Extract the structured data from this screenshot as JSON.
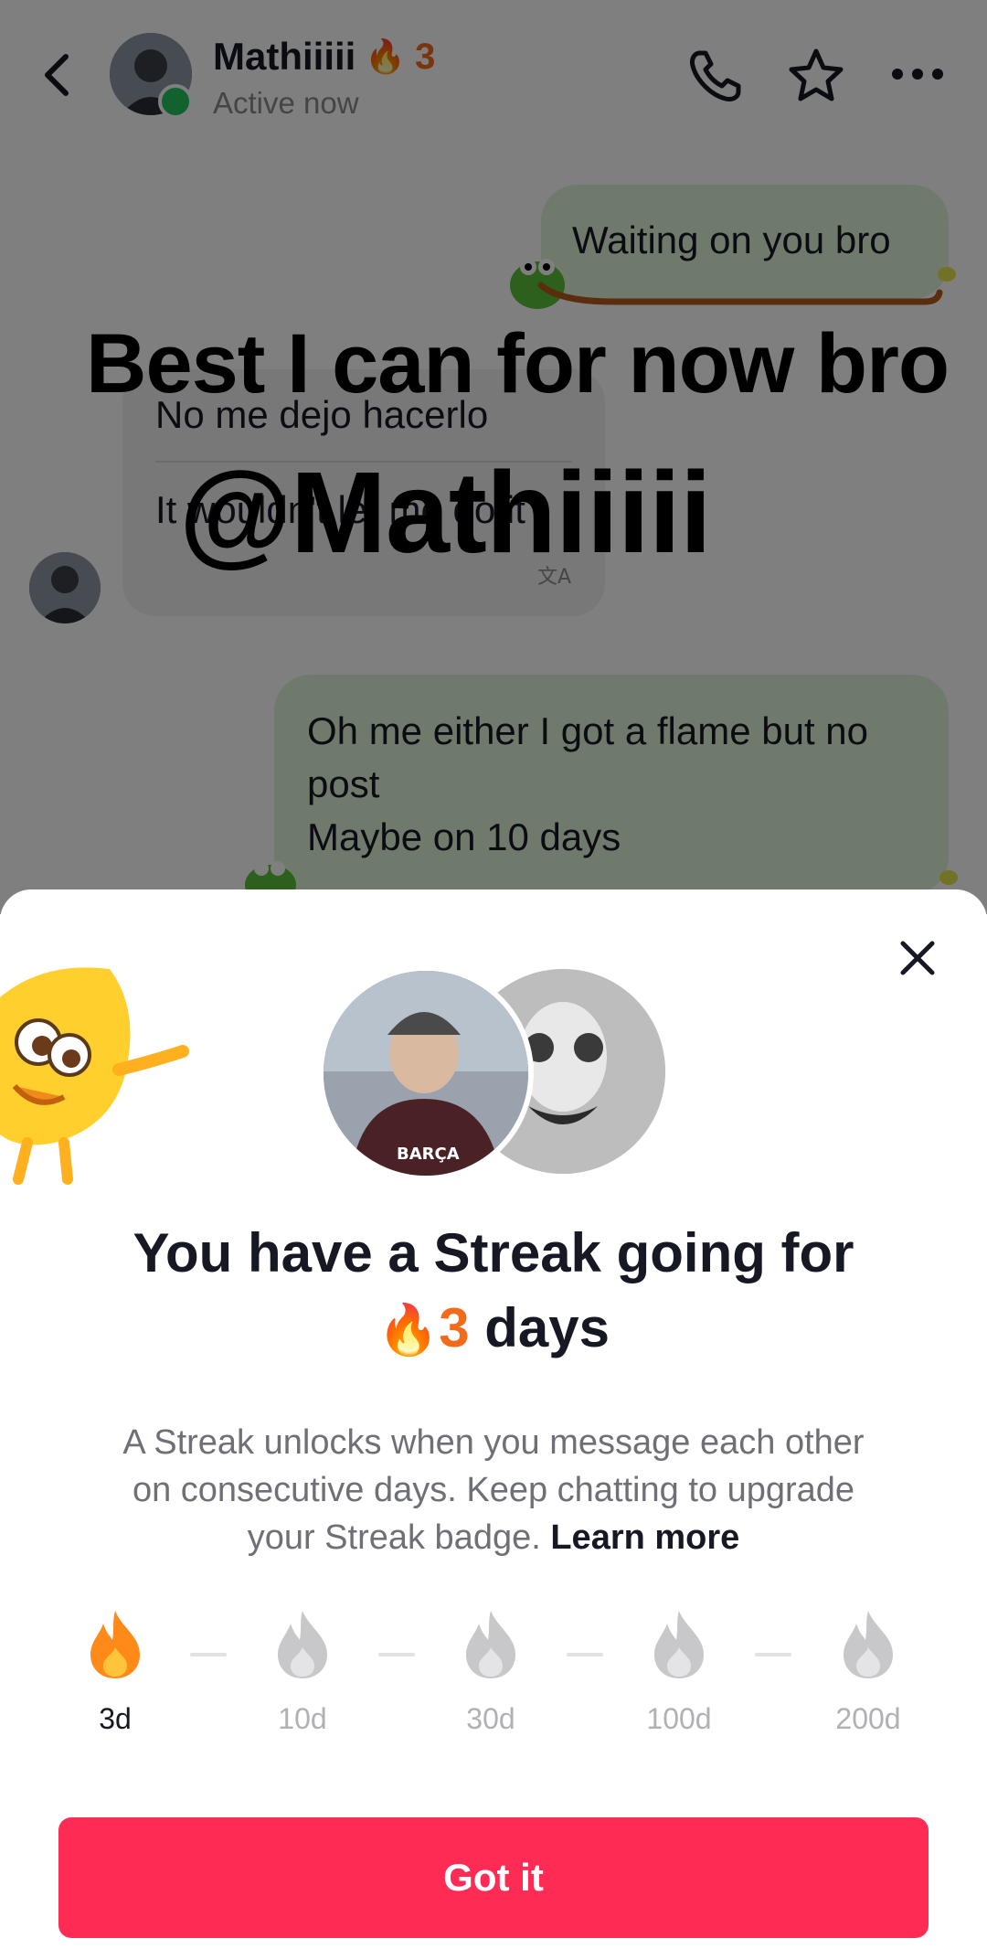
{
  "header": {
    "contact_name": "Mathiiiii",
    "streak_count": "3",
    "status": "Active now"
  },
  "messages": [
    {
      "from": "me",
      "lines": [
        "Waiting on you bro"
      ]
    },
    {
      "from": "them",
      "text": "No me dejo hacerlo",
      "translation": "It wouldn't let me do it"
    },
    {
      "from": "me",
      "lines": [
        "Oh me either I got a flame but no",
        "post",
        "Maybe on 10 days"
      ]
    }
  ],
  "overlay": {
    "caption": "Best I can for now bro",
    "handle": "@Mathiiiii"
  },
  "sheet": {
    "title_line1": "You have a Streak going for",
    "title_count": "3",
    "title_days": "days",
    "description_line1": "A Streak unlocks when you message each other",
    "description_line2": "on consecutive days. Keep chatting to upgrade",
    "description_line3": "your Streak badge.",
    "learn_more": "Learn more",
    "milestones": [
      "3d",
      "10d",
      "30d",
      "100d",
      "200d"
    ],
    "got_it": "Got it"
  },
  "colors": {
    "accent": "#fe2c55",
    "streak_orange": "#f26a1b",
    "bubble_out": "#dff3d8"
  }
}
